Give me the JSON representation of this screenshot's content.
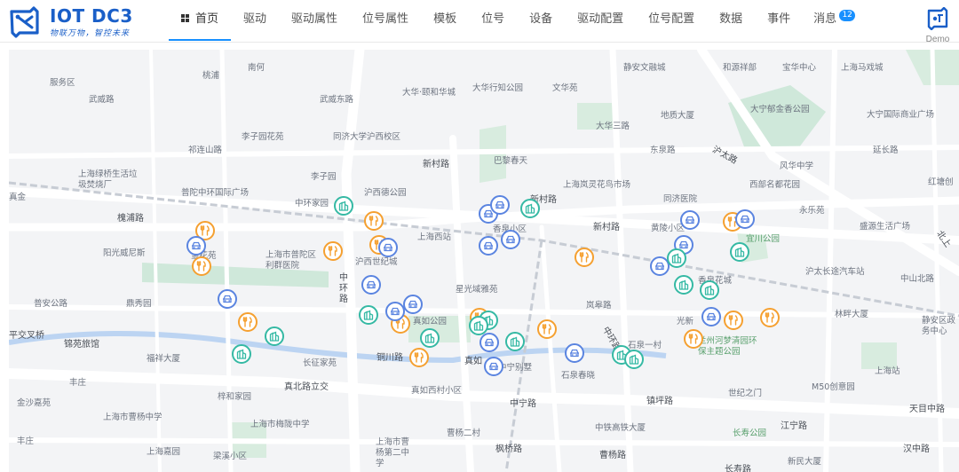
{
  "app": {
    "title": "IOT DC3",
    "slogan": "物联万物，智控未来"
  },
  "nav": {
    "items": [
      {
        "label": "首页",
        "active": true
      },
      {
        "label": "驱动"
      },
      {
        "label": "驱动属性"
      },
      {
        "label": "位号属性"
      },
      {
        "label": "模板"
      },
      {
        "label": "位号"
      },
      {
        "label": "设备"
      },
      {
        "label": "驱动配置"
      },
      {
        "label": "位号配置"
      },
      {
        "label": "数据"
      },
      {
        "label": "事件"
      },
      {
        "label": "消息",
        "badge": "12"
      }
    ]
  },
  "user": {
    "name": "Demo",
    "icon": "iot-logo-icon"
  },
  "colors": {
    "accent": "#1890ff",
    "brand": "#1a5fc8",
    "marker_orange": "#f5a030",
    "marker_blue": "#5a84e0",
    "marker_teal": "#35b9a4"
  },
  "map": {
    "labels": [
      "服务区",
      "武威路",
      "桃浦",
      "南何",
      "武威东路",
      "大华·颐和华城",
      "大华行知公园",
      "文华苑",
      "静安文融城",
      "和源祥部",
      "宝华中心",
      "上海马戏城",
      "祁连山路",
      "李子园花苑",
      "同济大学沪西校区",
      "大华三路",
      "地质大厦",
      "大宁郁金香公园",
      "大宁国际商业广场",
      "东泉路",
      "延长路",
      "李子园",
      "新村路",
      "巴黎春天",
      "沪太路",
      "风华中学",
      "上海绿桥生活垃圾焚烧厂",
      "真金",
      "上海岚灵花鸟市场",
      "西部名都花园",
      "新村路",
      "同济医院",
      "红塘创",
      "普陀中环国际广场",
      "沪西德公园",
      "中环家园",
      "永乐苑",
      "槐浦路",
      "上海西站",
      "香泉小区",
      "新村路",
      "黄陵小区",
      "宜川公园",
      "盛源生活广场",
      "北上",
      "金花苑",
      "上海市普陀区利群医院",
      "沪西世纪城",
      "阳光威尼斯",
      "沪太长途汽车站",
      "中环路",
      "中山北路",
      "香泉花城",
      "星光域雅苑",
      "岚皋路",
      "林畔大厦",
      "普安公路",
      "鼎秀园",
      "光新",
      "中环路",
      "静安区政务中心",
      "真如公园",
      "平交叉桥",
      "锦苑旅馆",
      "福祥大厦",
      "长征家苑",
      "铜川路",
      "真如",
      "石泉一村",
      "中宁别墅",
      "石泉春晓",
      "兰州河梦清园环保主题公园",
      "上海站",
      "丰庄",
      "梓和家园",
      "真北路立交",
      "真如西村小区",
      "中宁路",
      "镇坪路",
      "世纪之门",
      "M50创意园",
      "金沙嘉苑",
      "上海市曹杨中学",
      "上海市梅陇中学",
      "中铁高铁大厦",
      "长寿公园",
      "江宁路",
      "天目中路",
      "丰庄",
      "上海嘉园",
      "曹杨二村",
      "上海市曹杨第二中学",
      "枫桥路",
      "曹杨路",
      "长寿路",
      "汉中路",
      "新民大厦",
      "梁溪小区"
    ],
    "markers": [
      {
        "icon": "restaurant-icon",
        "color": "orange"
      },
      {
        "icon": "restaurant-icon",
        "color": "orange"
      },
      {
        "icon": "restaurant-icon",
        "color": "orange"
      },
      {
        "icon": "restaurant-icon",
        "color": "orange"
      },
      {
        "icon": "restaurant-icon",
        "color": "orange"
      },
      {
        "icon": "restaurant-icon",
        "color": "orange"
      },
      {
        "icon": "restaurant-icon",
        "color": "orange"
      },
      {
        "icon": "restaurant-icon",
        "color": "orange"
      },
      {
        "icon": "restaurant-icon",
        "color": "orange"
      },
      {
        "icon": "restaurant-icon",
        "color": "orange"
      },
      {
        "icon": "restaurant-icon",
        "color": "orange"
      },
      {
        "icon": "restaurant-icon",
        "color": "orange"
      },
      {
        "icon": "restaurant-icon",
        "color": "orange"
      },
      {
        "icon": "restaurant-icon",
        "color": "orange"
      },
      {
        "icon": "restaurant-icon",
        "color": "orange"
      },
      {
        "icon": "car-icon",
        "color": "blue"
      },
      {
        "icon": "car-icon",
        "color": "blue"
      },
      {
        "icon": "car-icon",
        "color": "blue"
      },
      {
        "icon": "car-icon",
        "color": "blue"
      },
      {
        "icon": "car-icon",
        "color": "blue"
      },
      {
        "icon": "car-icon",
        "color": "blue"
      },
      {
        "icon": "car-icon",
        "color": "blue"
      },
      {
        "icon": "car-icon",
        "color": "blue"
      },
      {
        "icon": "car-icon",
        "color": "blue"
      },
      {
        "icon": "car-icon",
        "color": "blue"
      },
      {
        "icon": "car-icon",
        "color": "blue"
      },
      {
        "icon": "car-icon",
        "color": "blue"
      },
      {
        "icon": "car-icon",
        "color": "blue"
      },
      {
        "icon": "car-icon",
        "color": "blue"
      },
      {
        "icon": "car-icon",
        "color": "blue"
      },
      {
        "icon": "car-icon",
        "color": "blue"
      },
      {
        "icon": "car-icon",
        "color": "blue"
      },
      {
        "icon": "car-icon",
        "color": "blue"
      },
      {
        "icon": "building-icon",
        "color": "teal"
      },
      {
        "icon": "building-icon",
        "color": "teal"
      },
      {
        "icon": "building-icon",
        "color": "teal"
      },
      {
        "icon": "building-icon",
        "color": "teal"
      },
      {
        "icon": "building-icon",
        "color": "teal"
      },
      {
        "icon": "building-icon",
        "color": "teal"
      },
      {
        "icon": "building-icon",
        "color": "teal"
      },
      {
        "icon": "building-icon",
        "color": "teal"
      },
      {
        "icon": "building-icon",
        "color": "teal"
      },
      {
        "icon": "building-icon",
        "color": "teal"
      },
      {
        "icon": "building-icon",
        "color": "teal"
      },
      {
        "icon": "building-icon",
        "color": "teal"
      },
      {
        "icon": "building-icon",
        "color": "teal"
      },
      {
        "icon": "building-icon",
        "color": "teal"
      },
      {
        "icon": "building-icon",
        "color": "teal"
      }
    ]
  }
}
